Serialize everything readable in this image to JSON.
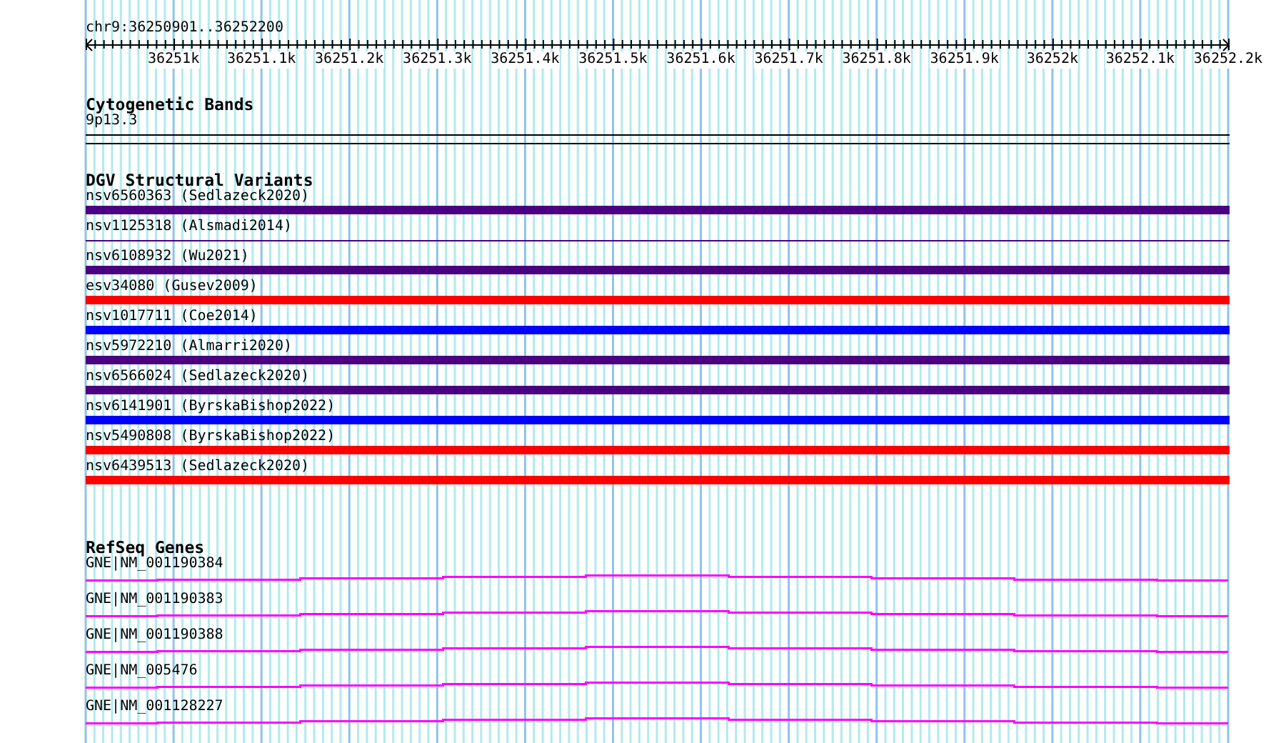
{
  "ruler": {
    "title": "chr9:36250901..36252200",
    "ticks": [
      "36251k",
      "36251.1k",
      "36251.2k",
      "36251.3k",
      "36251.4k",
      "36251.5k",
      "36251.6k",
      "36251.7k",
      "36251.8k",
      "36251.9k",
      "36252k",
      "36252.1k",
      "36252.2k"
    ]
  },
  "cytogenetic_bands": {
    "title": "Cytogenetic Bands",
    "band": "9p13.3"
  },
  "dgv_structural_variants": {
    "title": "DGV Structural Variants",
    "items": [
      {
        "label": "nsv6560363 (Sedlazeck2020)",
        "color": "#4b0082",
        "kind": "bar"
      },
      {
        "label": "nsv1125318 (Alsmadi2014)",
        "color": "#4b0082",
        "kind": "line"
      },
      {
        "label": "nsv6108932 (Wu2021)",
        "color": "#4b0082",
        "kind": "bar"
      },
      {
        "label": "esv34080 (Gusev2009)",
        "color": "#ff0000",
        "kind": "bar"
      },
      {
        "label": "nsv1017711 (Coe2014)",
        "color": "#0000ff",
        "kind": "bar"
      },
      {
        "label": "nsv5972210 (Almarri2020)",
        "color": "#4b0082",
        "kind": "bar"
      },
      {
        "label": "nsv6566024 (Sedlazeck2020)",
        "color": "#4b0082",
        "kind": "bar"
      },
      {
        "label": "nsv6141901 (ByrskaBishop2022)",
        "color": "#0000ff",
        "kind": "bar"
      },
      {
        "label": "nsv5490808 (ByrskaBishop2022)",
        "color": "#ff0000",
        "kind": "bar"
      },
      {
        "label": "nsv6439513 (Sedlazeck2020)",
        "color": "#ff0000",
        "kind": "bar"
      }
    ]
  },
  "refseq_genes": {
    "title": "RefSeq Genes",
    "items": [
      {
        "label": "GNE|NM_001190384"
      },
      {
        "label": "GNE|NM_001190383"
      },
      {
        "label": "GNE|NM_001190388"
      },
      {
        "label": "GNE|NM_005476"
      },
      {
        "label": "GNE|NM_001128227"
      }
    ]
  }
}
